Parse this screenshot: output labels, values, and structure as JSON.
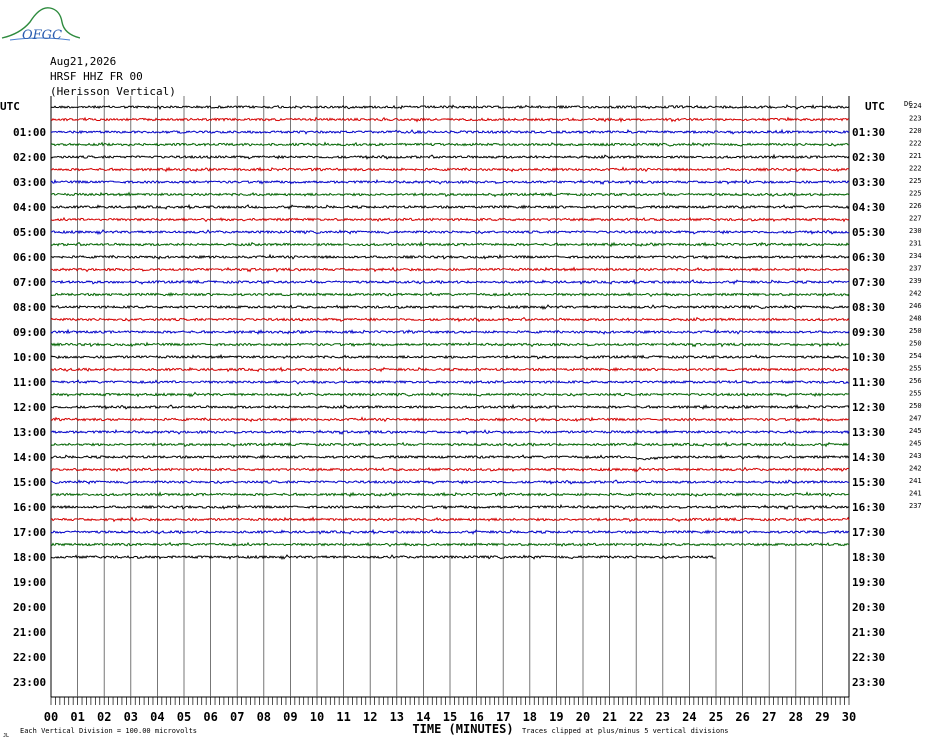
{
  "header": {
    "logo_text": "OFGC",
    "date": "Aug21,2026",
    "station": "HRSF HHZ FR 00",
    "description": "(Herisson Vertical)"
  },
  "chart_data": {
    "type": "line",
    "kind": "helicorder",
    "left_axis_title": "UTC",
    "right_axis_title": "UTC",
    "right_column_title": "DC",
    "left_hour_labels": [
      "01:00",
      "02:00",
      "03:00",
      "04:00",
      "05:00",
      "06:00",
      "07:00",
      "08:00",
      "09:00",
      "10:00",
      "11:00",
      "12:00",
      "13:00",
      "14:00",
      "15:00",
      "16:00",
      "17:00",
      "18:00",
      "19:00",
      "20:00",
      "21:00",
      "22:00",
      "23:00"
    ],
    "right_hour_labels": [
      "01:30",
      "02:30",
      "03:30",
      "04:30",
      "05:30",
      "06:30",
      "07:30",
      "08:30",
      "09:30",
      "10:30",
      "11:30",
      "12:30",
      "13:30",
      "14:30",
      "15:30",
      "16:30",
      "17:30",
      "18:30",
      "19:30",
      "20:30",
      "21:30",
      "22:30",
      "23:30"
    ],
    "xlabel": "TIME (MINUTES)",
    "x_ticks": [
      "00",
      "01",
      "02",
      "03",
      "04",
      "05",
      "06",
      "07",
      "08",
      "09",
      "10",
      "11",
      "12",
      "13",
      "14",
      "15",
      "16",
      "17",
      "18",
      "19",
      "20",
      "21",
      "22",
      "23",
      "24",
      "25",
      "26",
      "27",
      "28",
      "29",
      "30"
    ],
    "xlim": [
      0,
      30
    ],
    "rows_per_hour": 2,
    "trace_colors": [
      "#000000",
      "#d40000",
      "#0000c8",
      "#006400"
    ],
    "dc_offsets": [
      224,
      223,
      220,
      222,
      221,
      222,
      225,
      225,
      226,
      227,
      230,
      231,
      234,
      237,
      239,
      242,
      246,
      248,
      250,
      250,
      254,
      255,
      256,
      255,
      250,
      247,
      245,
      245,
      243,
      242,
      241,
      241,
      237
    ],
    "traces_drawn": 37,
    "last_trace_end_minute": 25,
    "events": [
      {
        "row": 28,
        "minute": 22.5,
        "note": "long-period dip"
      }
    ],
    "footer_left": "Each Vertical Division =  100.00 microvolts",
    "footer_right": "Traces clipped at plus/minus 5 vertical divisions",
    "footer_mark": "JL"
  }
}
